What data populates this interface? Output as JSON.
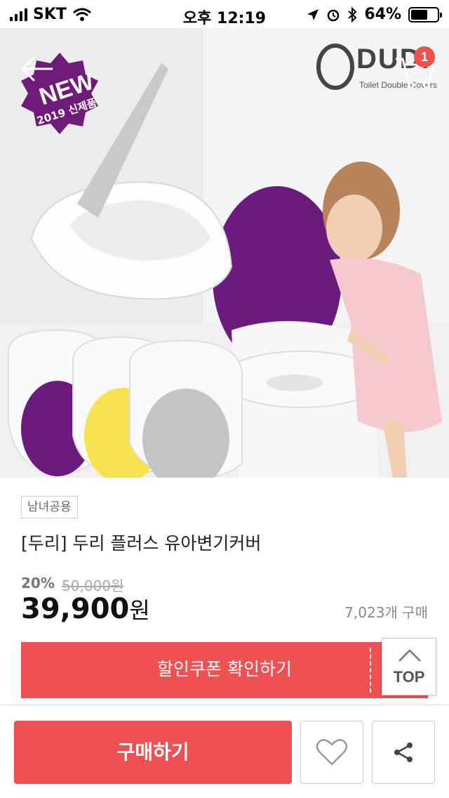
{
  "status_bar": {
    "carrier": "SKT",
    "time": "오후 12:19",
    "battery": "64%",
    "battery_level": 0.64
  },
  "hero": {
    "badge_main": "NEW",
    "badge_sub": "2019 신제품",
    "brand_name": "DUDI",
    "brand_tagline": "Toilet Double Covers",
    "cart_count": "1",
    "colors": [
      "#6b1a7e",
      "#f7e250",
      "#c4c4c4"
    ]
  },
  "product": {
    "tag": "남녀공용",
    "title": "[두리] 두리 플러스 유아변기커버",
    "discount": "20%",
    "original_price": "50,000원",
    "price": "39,900",
    "price_unit": "원",
    "sold_count": "7,023개 구매"
  },
  "actions": {
    "coupon_label": "할인쿠폰 확인하기",
    "top_label": "TOP",
    "buy_label": "구매하기"
  },
  "icons": {
    "back": "back-arrow-icon",
    "cart": "cart-icon",
    "wishlist": "heart-icon",
    "share": "share-icon"
  },
  "theme": {
    "accent": "#ef5052"
  }
}
